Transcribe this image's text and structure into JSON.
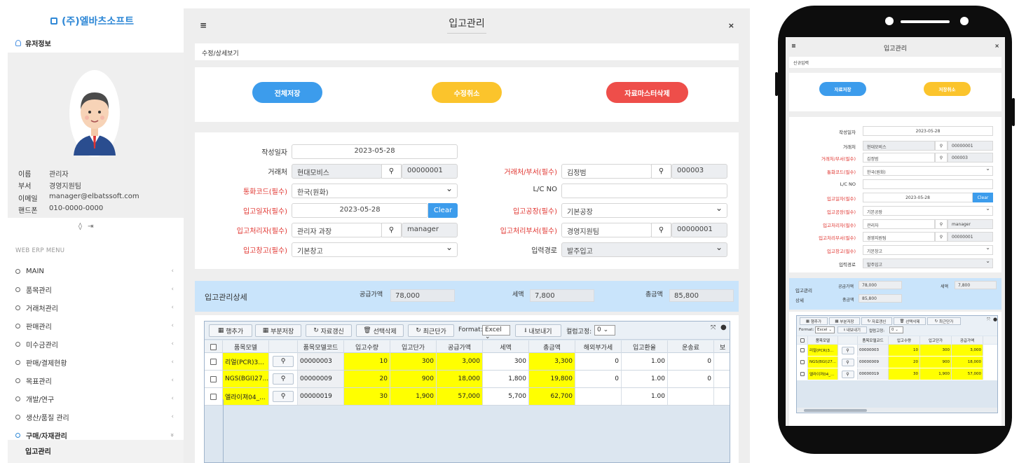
{
  "sidebar": {
    "brand": "(주)엘바츠소프트",
    "user_section_title": "유저정보",
    "user": [
      {
        "key": "이름",
        "value": "관리자"
      },
      {
        "key": "부서",
        "value": "경영지원팀"
      },
      {
        "key": "이메일",
        "value": "manager@elbatssoft.com"
      },
      {
        "key": "핸드폰",
        "value": "010-0000-0000"
      }
    ],
    "menu_header": "WEB ERP MENU",
    "menu": [
      {
        "label": "MAIN",
        "chev": "‹"
      },
      {
        "label": "품목관리",
        "chev": "‹"
      },
      {
        "label": "거래처관리",
        "chev": "‹"
      },
      {
        "label": "판매관리",
        "chev": "‹"
      },
      {
        "label": "미수금관리",
        "chev": "‹"
      },
      {
        "label": "판매/결제현황",
        "chev": "‹"
      },
      {
        "label": "목표관리",
        "chev": "‹"
      },
      {
        "label": "개발/연구",
        "chev": "‹"
      },
      {
        "label": "생산/품질 관리",
        "chev": "‹"
      },
      {
        "label": "구매/자재관리",
        "chev": "»"
      }
    ],
    "submenu_active": "입고관리"
  },
  "main": {
    "title": "입고관리",
    "breadcrumb": "수정/상세보기",
    "buttons": {
      "save_all": "전체저장",
      "cancel_edit": "수정취소",
      "delete_master": "자료마스터삭제"
    },
    "form": {
      "created_date_label": "작성일자",
      "created_date": "2023-05-28",
      "client_label": "거래처",
      "client_name": "현대모비스",
      "client_code": "00000001",
      "client_dept_label": "거래처/부서(필수)",
      "client_dept_name": "김정범",
      "client_dept_code": "000003",
      "currency_label": "통화코드(필수)",
      "currency": "한국(원화)",
      "lc_label": "L/C NO",
      "lc_value": "",
      "in_date_label": "입고일자(필수)",
      "in_date": "2023-05-28",
      "clear_label": "Clear",
      "factory_label": "입고공장(필수)",
      "factory": "기본공장",
      "handler_label": "입고처리자(필수)",
      "handler_name": "관리자 과장",
      "handler_code": "manager",
      "handler_dept_label": "입고처리부서(필수)",
      "handler_dept_name": "경영지원팀",
      "handler_dept_code": "00000001",
      "warehouse_label": "입고창고(필수)",
      "warehouse": "기본창고",
      "route_label": "입력경로",
      "route": "발주입고"
    },
    "detail": {
      "title": "입고관리상세",
      "supply_label": "공급가액",
      "supply": "78,000",
      "tax_label": "세액",
      "tax": "7,800",
      "total_label": "총금액",
      "total": "85,800"
    },
    "toolbar": {
      "add_row": "행추가",
      "partial_save": "부분저장",
      "refresh": "자료갱신",
      "delete_selected": "선택삭제",
      "recent_price": "최근단가",
      "format_label": "Format:",
      "format_value": "Excel",
      "export": "내보내기",
      "freeze_label": "컬럼고정:",
      "freeze_value": "0"
    },
    "grid": {
      "columns": [
        "품목모델",
        "품목모델코드",
        "입고수량",
        "입고단가",
        "공급가액",
        "세액",
        "총금액",
        "해외부가세",
        "입고환율",
        "운송료",
        "보"
      ],
      "rows": [
        {
          "model": "리얼(PCR)3...",
          "code": "00000003",
          "qty": "10",
          "price": "300",
          "supply": "3,000",
          "tax": "300",
          "total": "3,300",
          "overseas_vat": "0",
          "rate": "1.00",
          "freight": "0"
        },
        {
          "model": "NGS(BGI)27...",
          "code": "00000009",
          "qty": "20",
          "price": "900",
          "supply": "18,000",
          "tax": "1,800",
          "total": "19,800",
          "overseas_vat": "0",
          "rate": "1.00",
          "freight": "0"
        },
        {
          "model": "엘라이져04_...",
          "code": "00000019",
          "qty": "30",
          "price": "1,900",
          "supply": "57,000",
          "tax": "5,700",
          "total": "62,700",
          "overseas_vat": "",
          "rate": "1.00",
          "freight": ""
        }
      ]
    }
  },
  "phone": {
    "title": "입고관리",
    "breadcrumb": "신규입력",
    "buttons": {
      "save_all": "자료저장",
      "cancel_edit": "저장취소"
    },
    "form": {
      "created_date_label": "작성일자",
      "created_date": "2023-05-28",
      "client_label": "거래처",
      "client_name": "현대모비스",
      "client_code": "00000001",
      "client_dept_label": "거래처/부서(필수)",
      "client_dept_name": "김정범",
      "client_dept_code": "000003",
      "currency_label": "통화코드(필수)",
      "currency": "한국(원화)",
      "lc_label": "L/C NO",
      "in_date_label": "입고일자(필수)",
      "in_date": "2023-05-28",
      "clear_label": "Clear",
      "factory_label": "입고공장(필수)",
      "factory": "기본공장",
      "handler_label": "입고처리자(필수)",
      "handler_name": "관리자",
      "handler_code": "manager",
      "handler_dept_label": "입고처리부서(필수)",
      "handler_dept_name": "경영지원팀",
      "handler_dept_code": "00000001",
      "warehouse_label": "입고창고(필수)",
      "warehouse": "기본창고",
      "route_label": "입력경로",
      "route": "발주입고"
    },
    "detail": {
      "title_line1": "입고관리",
      "title_line2": "상세",
      "supply_label": "공급가액",
      "supply": "78,000",
      "tax_label": "세액",
      "tax": "7,800",
      "total_label": "총금액",
      "total": "85,800"
    },
    "toolbar": {
      "add_row": "행추가",
      "partial_save": "부분저장",
      "refresh": "자료갱신",
      "delete_selected": "선택삭제",
      "recent_price": "최근단가",
      "format_label": "Format:",
      "format_value": "Excel",
      "export": "내보내기",
      "freeze_label": "컬럼고정:",
      "freeze_value": "0"
    },
    "grid": {
      "columns": [
        "품목모델",
        "품목모델코드",
        "입고수량",
        "입고단가",
        "공급가액"
      ],
      "rows": [
        {
          "model": "리얼(PCR)3...",
          "code": "00000003",
          "qty": "10",
          "price": "300",
          "supply": "3,000"
        },
        {
          "model": "NGS(BGI)27...",
          "code": "00000009",
          "qty": "20",
          "price": "900",
          "supply": "18,000"
        },
        {
          "model": "엘라이져04_...",
          "code": "00000019",
          "qty": "30",
          "price": "1,900",
          "supply": "57,000"
        }
      ]
    }
  },
  "icons": {
    "magnifier": "🔍",
    "close": "×",
    "menu": "≡"
  }
}
